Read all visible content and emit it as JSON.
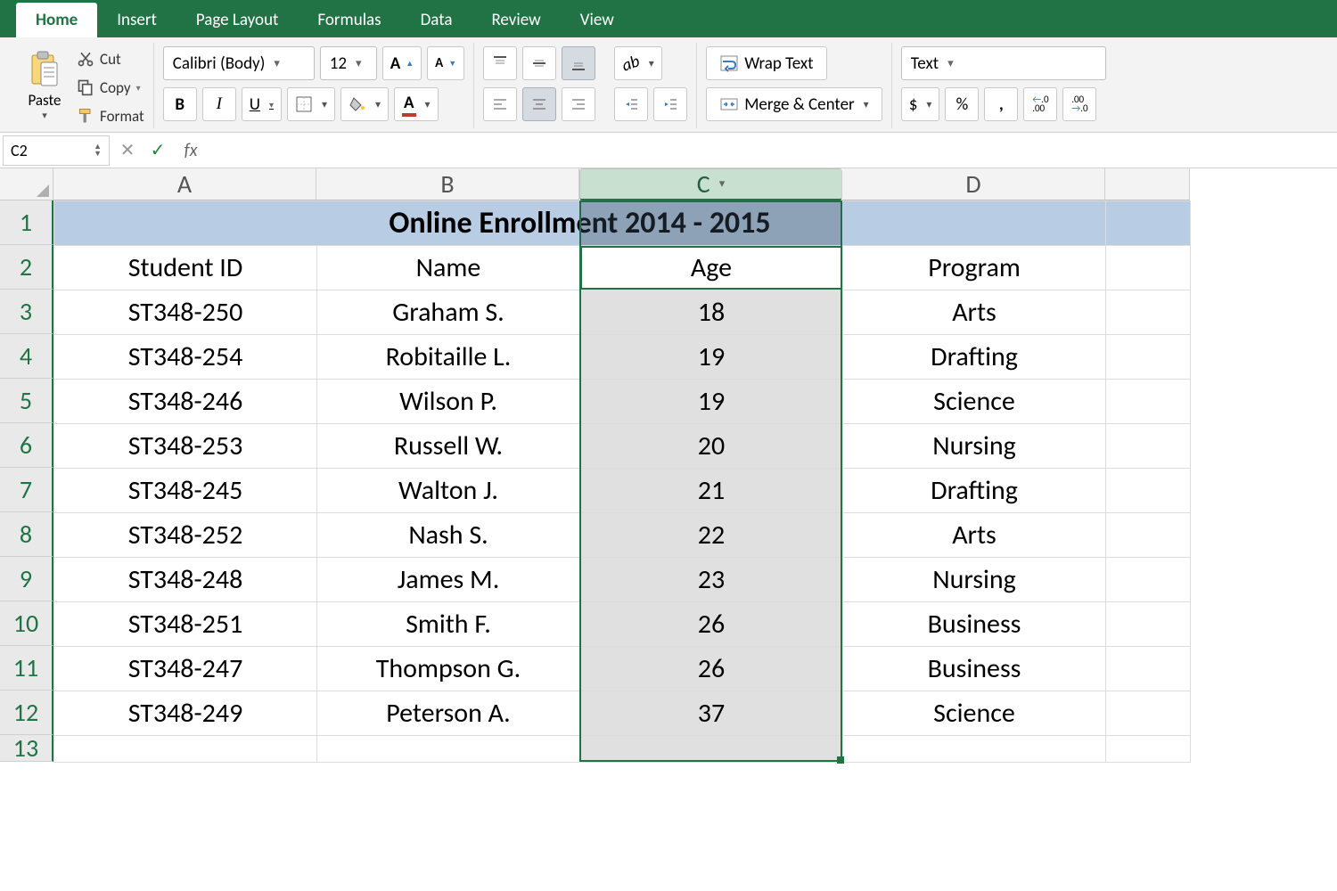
{
  "tabs": [
    "Home",
    "Insert",
    "Page Layout",
    "Formulas",
    "Data",
    "Review",
    "View"
  ],
  "active_tab": 0,
  "clipboard": {
    "paste": "Paste",
    "cut": "Cut",
    "copy": "Copy",
    "format": "Format"
  },
  "font": {
    "name": "Calibri (Body)",
    "size": "12",
    "grow": "A",
    "shrink": "A",
    "bold": "B",
    "italic": "I",
    "underline": "U"
  },
  "alignment": {
    "wrap": "Wrap Text",
    "merge": "Merge & Center"
  },
  "number": {
    "format": "Text",
    "currency": "$",
    "percent": "%",
    "comma": "❯",
    "inc_dec_ic1": ".0",
    "inc_dec_ic2": ".00"
  },
  "namebox": "C2",
  "formula": "",
  "columns": [
    "A",
    "B",
    "C",
    "D",
    ""
  ],
  "selected_col_index": 2,
  "row_count": 13,
  "title": "Online Enrollment 2014 - 2015",
  "headers": [
    "Student ID",
    "Name",
    "Age",
    "Program"
  ],
  "rows": [
    [
      "ST348-250",
      "Graham S.",
      "18",
      "Arts"
    ],
    [
      "ST348-254",
      "Robitaille L.",
      "19",
      "Drafting"
    ],
    [
      "ST348-246",
      "Wilson P.",
      "19",
      "Science"
    ],
    [
      "ST348-253",
      "Russell W.",
      "20",
      "Nursing"
    ],
    [
      "ST348-245",
      "Walton J.",
      "21",
      "Drafting"
    ],
    [
      "ST348-252",
      "Nash S.",
      "22",
      "Arts"
    ],
    [
      "ST348-248",
      "James M.",
      "23",
      "Nursing"
    ],
    [
      "ST348-251",
      "Smith F.",
      "26",
      "Business"
    ],
    [
      "ST348-247",
      "Thompson G.",
      "26",
      "Business"
    ],
    [
      "ST348-249",
      "Peterson A.",
      "37",
      "Science"
    ]
  ],
  "colors": {
    "ribbon": "#217346",
    "title_fill": "#b8cce4"
  }
}
